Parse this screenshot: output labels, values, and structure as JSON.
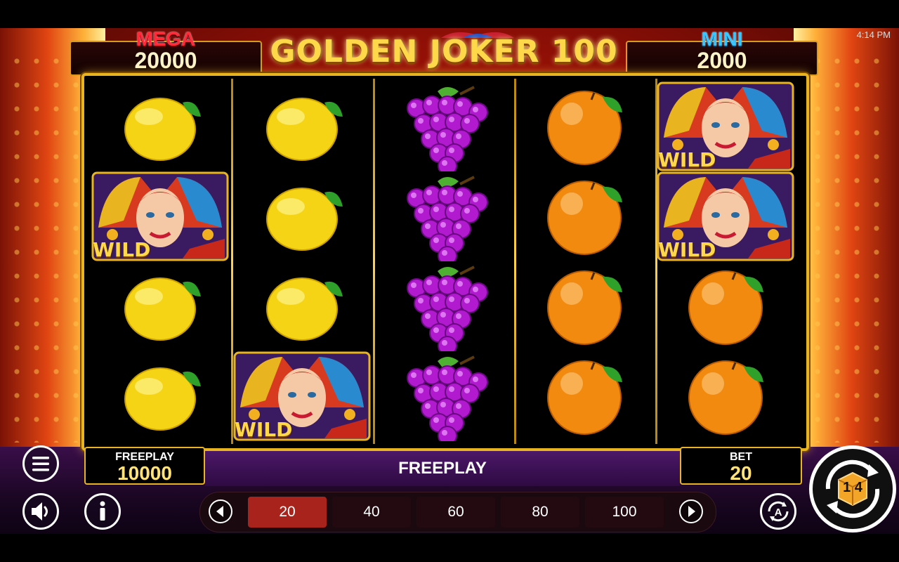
{
  "status_bar": {
    "time": "4:14 PM"
  },
  "title": "GOLDEN JOKER 100",
  "jackpots": {
    "mega": {
      "label": "MEGA",
      "value": "20000"
    },
    "mini": {
      "label": "MINI",
      "value": "2000"
    }
  },
  "reels": [
    [
      "lemon",
      "joker-wild",
      "lemon",
      "lemon"
    ],
    [
      "lemon",
      "lemon",
      "lemon",
      "joker-wild"
    ],
    [
      "grapes",
      "grapes",
      "grapes",
      "grapes"
    ],
    [
      "orange",
      "orange",
      "orange",
      "orange"
    ],
    [
      "joker-wild",
      "joker-wild",
      "orange",
      "orange"
    ]
  ],
  "wild_label": "WILD",
  "balance": {
    "label": "FREEPLAY",
    "value": "10000"
  },
  "banner": "FREEPLAY",
  "bet": {
    "label": "BET",
    "value": "20"
  },
  "bet_options": [
    "20",
    "40",
    "60",
    "80",
    "100"
  ],
  "selected_bet": "20",
  "spin_button": {
    "digits": "1 4"
  },
  "icons": {
    "menu": "hamburger-menu-icon",
    "sound": "speaker-icon",
    "info": "info-icon",
    "autoplay": "autoplay-icon",
    "prev": "chevron-left-icon",
    "next": "chevron-right-icon",
    "spin": "spin-icon"
  },
  "colors": {
    "gold": "#e8b420",
    "bet_selected": "#a8231c",
    "banner": "#3e1156",
    "mega": "#ff2a3a",
    "mini": "#38c6ff"
  }
}
